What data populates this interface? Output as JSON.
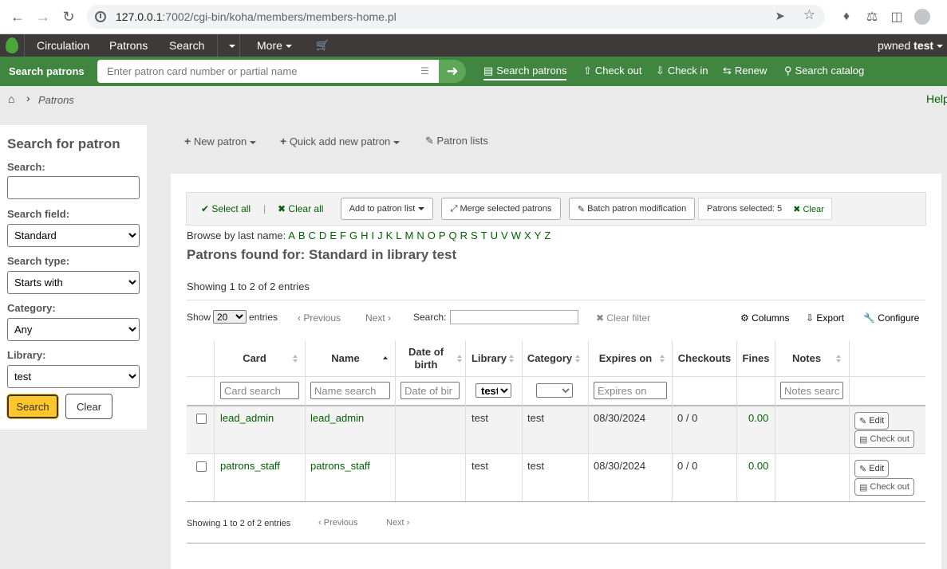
{
  "browser": {
    "url_host": "127.0.0.1",
    "url_rest": ":7002/cgi-bin/koha/members/members-home.pl"
  },
  "topnav": {
    "items": [
      "Circulation",
      "Patrons",
      "Search",
      "More"
    ],
    "user_first": "pwned",
    "user_last": "test"
  },
  "searchbar": {
    "label": "Search patrons",
    "placeholder": "Enter patron card number or partial name",
    "links": [
      "Search patrons",
      "Check out",
      "Check in",
      "Renew",
      "Search catalog"
    ]
  },
  "breadcrumb": {
    "current": "Patrons",
    "help": "Help"
  },
  "sidebar": {
    "title": "Search for patron",
    "search_label": "Search:",
    "search_value": "",
    "field_label": "Search field:",
    "field_value": "Standard",
    "type_label": "Search type:",
    "type_value": "Starts with",
    "category_label": "Category:",
    "category_value": "Any",
    "library_label": "Library:",
    "library_value": "test",
    "search_button": "Search",
    "clear_button": "Clear"
  },
  "toolbar": {
    "new_patron": "New patron",
    "quick_add": "Quick add new patron",
    "patron_lists": "Patron lists"
  },
  "selection": {
    "select_all": "Select all",
    "clear_all": "Clear all",
    "add_to_list": "Add to patron list",
    "merge": "Merge selected patrons",
    "batch": "Batch patron modification",
    "selected_text": "Patrons selected: 5",
    "clear": "Clear"
  },
  "browse": {
    "label": "Browse by last name:",
    "letters": [
      "A",
      "B",
      "C",
      "D",
      "E",
      "F",
      "G",
      "H",
      "I",
      "J",
      "K",
      "L",
      "M",
      "N",
      "O",
      "P",
      "Q",
      "R",
      "S",
      "T",
      "U",
      "V",
      "W",
      "X",
      "Y",
      "Z"
    ]
  },
  "results": {
    "heading": "Patrons found for: Standard in library test",
    "showing_top": "Showing 1 to 2 of 2 entries",
    "showing_bottom": "Showing 1 to 2 of 2 entries",
    "show_label": "Show",
    "show_value": "20",
    "entries_label": "entries",
    "previous": "Previous",
    "next": "Next",
    "search_label": "Search:",
    "clear_filter": "Clear filter",
    "columns": "Columns",
    "export": "Export",
    "configure": "Configure"
  },
  "table": {
    "headers": [
      "Card",
      "Name",
      "Date of birth",
      "Library",
      "Category",
      "Expires on",
      "Checkouts",
      "Fines",
      "Notes"
    ],
    "filters": {
      "card": "Card search",
      "name": "Name search",
      "dob": "Date of bir",
      "library": "test",
      "expires": "Expires on",
      "notes": "Notes searc"
    },
    "rows": [
      {
        "card": "lead_admin",
        "name": "lead_admin",
        "dob": "",
        "library": "test",
        "category": "test",
        "expires": "08/30/2024",
        "checkouts": "0 / 0",
        "fines": "0.00",
        "notes": "",
        "edit": "Edit",
        "checkout": "Check out"
      },
      {
        "card": "patrons_staff",
        "name": "patrons_staff",
        "dob": "",
        "library": "test",
        "category": "test",
        "expires": "08/30/2024",
        "checkouts": "0 / 0",
        "fines": "0.00",
        "notes": "",
        "edit": "Edit",
        "checkout": "Check out"
      }
    ]
  },
  "colors": {
    "accent": "#408540",
    "nav": "#3f3a3a",
    "link": "#006100",
    "search_btn": "#ffc62b"
  }
}
